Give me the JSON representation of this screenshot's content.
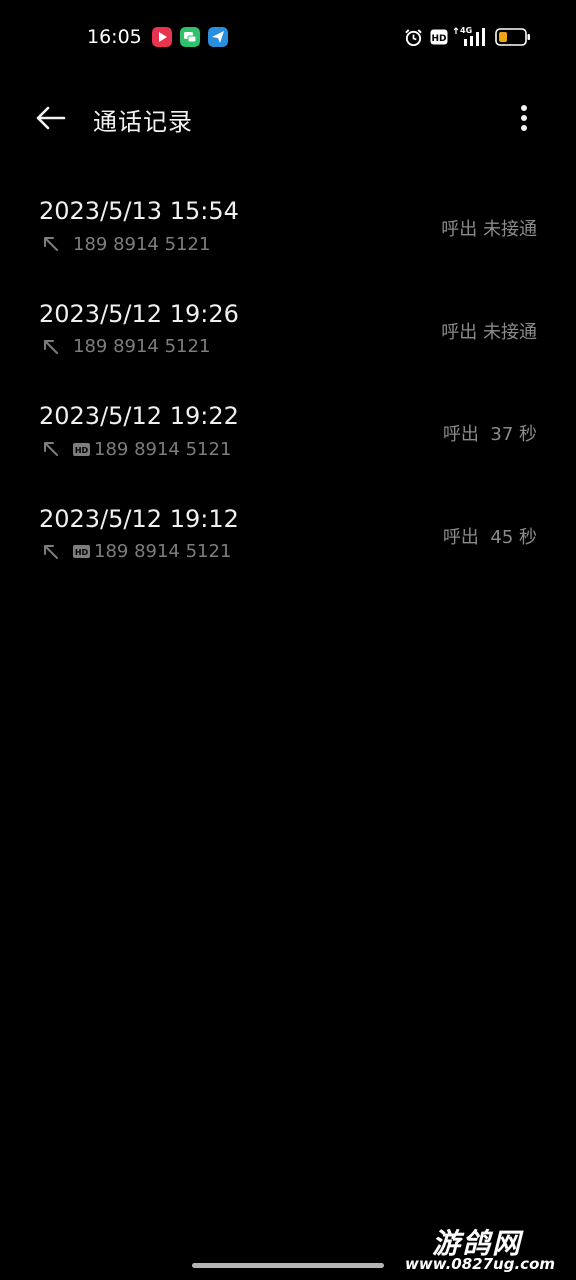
{
  "status_bar": {
    "time": "16:05",
    "apps": [
      {
        "icon": "video-app-icon",
        "color": "#e8344e"
      },
      {
        "icon": "chat-app-icon",
        "color": "#2ec26a"
      },
      {
        "icon": "paper-plane-app-icon",
        "color": "#2b8fe0"
      }
    ],
    "hd_label": "HD",
    "network_label": "4G",
    "battery_color": "#f0a21a"
  },
  "header": {
    "title": "通话记录"
  },
  "calls": [
    {
      "date": "2023/5/13 15:54",
      "number": "189 8914 5121",
      "hd": false,
      "status": "呼出 未接通"
    },
    {
      "date": "2023/5/12 19:26",
      "number": "189 8914 5121",
      "hd": false,
      "status": "呼出 未接通"
    },
    {
      "date": "2023/5/12 19:22",
      "number": "189 8914 5121",
      "hd": true,
      "hd_label": "HD",
      "status": "呼出  37 秒"
    },
    {
      "date": "2023/5/12 19:12",
      "number": "189 8914 5121",
      "hd": true,
      "hd_label": "HD",
      "status": "呼出  45 秒"
    }
  ],
  "watermark": {
    "title": "游鸽网",
    "url": "www.0827ug.com"
  }
}
